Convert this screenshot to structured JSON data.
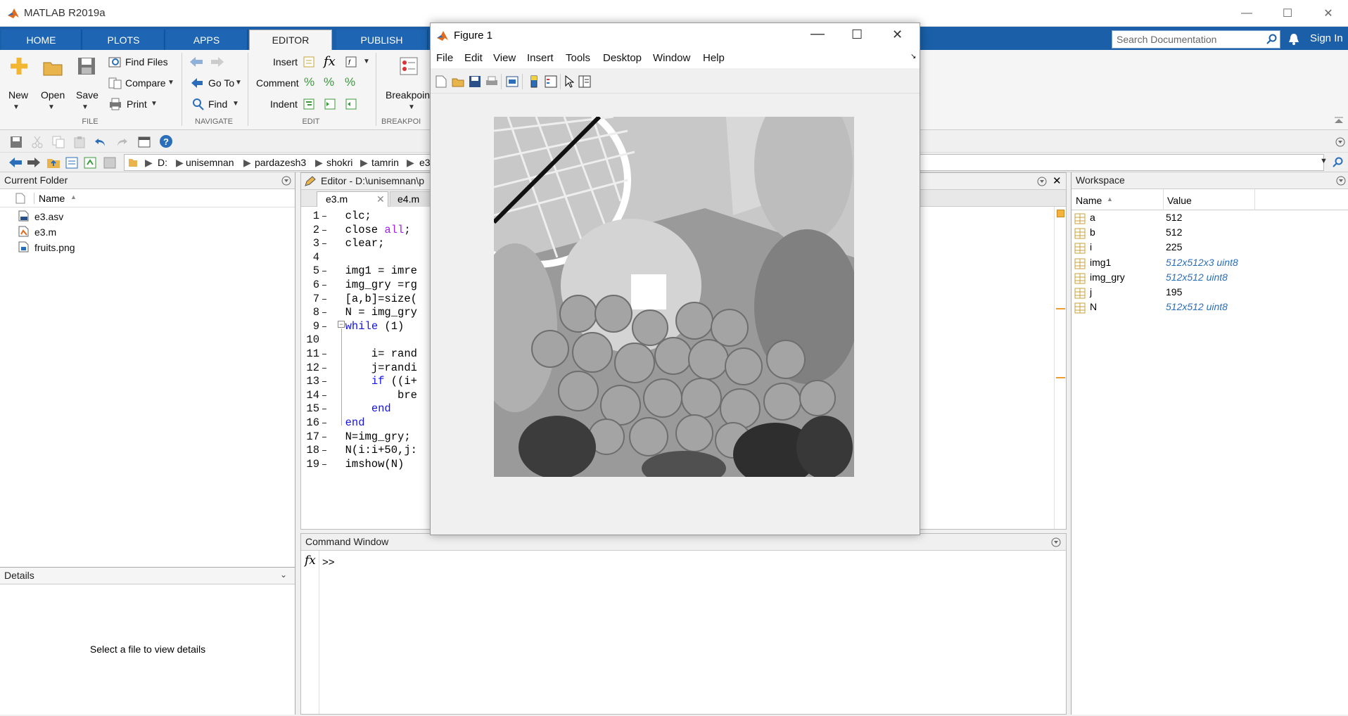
{
  "app": {
    "title": "MATLAB R2019a"
  },
  "tabs": [
    "HOME",
    "PLOTS",
    "APPS",
    "EDITOR",
    "PUBLISH"
  ],
  "search": {
    "placeholder": "Search Documentation"
  },
  "signin": "Sign In",
  "ribbon": {
    "file": {
      "new": "New",
      "open": "Open",
      "save": "Save",
      "find_files": "Find Files",
      "compare": "Compare",
      "print": "Print",
      "label": "FILE"
    },
    "navigate": {
      "go_to": "Go To",
      "find": "Find",
      "label": "NAVIGATE"
    },
    "edit": {
      "insert": "Insert",
      "comment": "Comment",
      "indent": "Indent",
      "label": "EDIT"
    },
    "breakpoints": {
      "button": "Breakpoints",
      "label": "BREAKPOI"
    }
  },
  "path": [
    "D:",
    "unisemnan",
    "pardazesh3",
    "shokri",
    "tamrin",
    "e3"
  ],
  "current_folder": {
    "title": "Current Folder",
    "column": "Name",
    "files": [
      "e3.asv",
      "e3.m",
      "fruits.png"
    ]
  },
  "details": {
    "title": "Details",
    "message": "Select a file to view details"
  },
  "editor": {
    "title": "Editor - D:\\unisemnan\\p",
    "tabs": [
      "e3.m",
      "e4.m"
    ],
    "lines": [
      {
        "n": "1",
        "code": "  clc;"
      },
      {
        "n": "2",
        "code": "  close all;"
      },
      {
        "n": "3",
        "code": "  clear;"
      },
      {
        "n": "4",
        "code": ""
      },
      {
        "n": "5",
        "code": "  img1 = imre"
      },
      {
        "n": "6",
        "code": "  img_gry =rg"
      },
      {
        "n": "7",
        "code": "  [a,b]=size("
      },
      {
        "n": "8",
        "code": "  N = img_gry"
      },
      {
        "n": "9",
        "code": "  while (1)"
      },
      {
        "n": "10",
        "code": ""
      },
      {
        "n": "11",
        "code": "      i= rand"
      },
      {
        "n": "12",
        "code": "      j=randi"
      },
      {
        "n": "13",
        "code": "      if ((i+"
      },
      {
        "n": "14",
        "code": "          bre"
      },
      {
        "n": "15",
        "code": "      end"
      },
      {
        "n": "16",
        "code": "  end"
      },
      {
        "n": "17",
        "code": "  N=img_gry;"
      },
      {
        "n": "18",
        "code": "  N(i:i+50,j:"
      },
      {
        "n": "19",
        "code": "  imshow(N)"
      }
    ]
  },
  "command_window": {
    "title": "Command Window",
    "prompt": ">>"
  },
  "workspace": {
    "title": "Workspace",
    "columns": [
      "Name",
      "Value"
    ],
    "vars": [
      {
        "name": "a",
        "value": "512",
        "dim": false
      },
      {
        "name": "b",
        "value": "512",
        "dim": false
      },
      {
        "name": "i",
        "value": "225",
        "dim": false
      },
      {
        "name": "img1",
        "value": "512x512x3 uint8",
        "dim": true
      },
      {
        "name": "img_gry",
        "value": "512x512 uint8",
        "dim": true
      },
      {
        "name": "j",
        "value": "195",
        "dim": false
      },
      {
        "name": "N",
        "value": "512x512 uint8",
        "dim": true
      }
    ]
  },
  "figure": {
    "title": "Figure 1",
    "menus": [
      "File",
      "Edit",
      "View",
      "Insert",
      "Tools",
      "Desktop",
      "Window",
      "Help"
    ]
  }
}
